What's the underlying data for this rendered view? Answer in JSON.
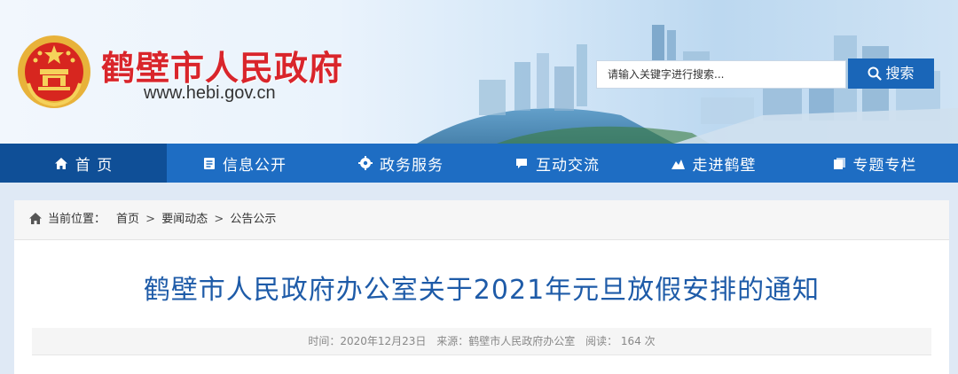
{
  "header": {
    "site_title": "鹤壁市人民政府",
    "site_url": "www.hebi.gov.cn",
    "search_placeholder": "请输入关键字进行搜索...",
    "search_button": "搜索"
  },
  "nav": {
    "items": [
      {
        "label": "首 页",
        "icon": "home-icon"
      },
      {
        "label": "信息公开",
        "icon": "document-icon"
      },
      {
        "label": "政务服务",
        "icon": "gear-icon"
      },
      {
        "label": "互动交流",
        "icon": "chat-icon"
      },
      {
        "label": "走进鹤壁",
        "icon": "mountain-icon"
      },
      {
        "label": "专题专栏",
        "icon": "pages-icon"
      }
    ]
  },
  "breadcrumb": {
    "prefix": "当前位置：",
    "items": [
      "首页",
      "要闻动态",
      "公告公示"
    ],
    "separator": ">"
  },
  "article": {
    "title": "鹤壁市人民政府办公室关于2021年元旦放假安排的通知",
    "time": "时间：2020年12月23日",
    "source": "来源：鹤壁市人民政府办公室",
    "views": "阅读： 164 次"
  },
  "colors": {
    "brand_red": "#d9252b",
    "nav_blue": "#1e6dc3",
    "title_blue": "#1e5ba8"
  }
}
